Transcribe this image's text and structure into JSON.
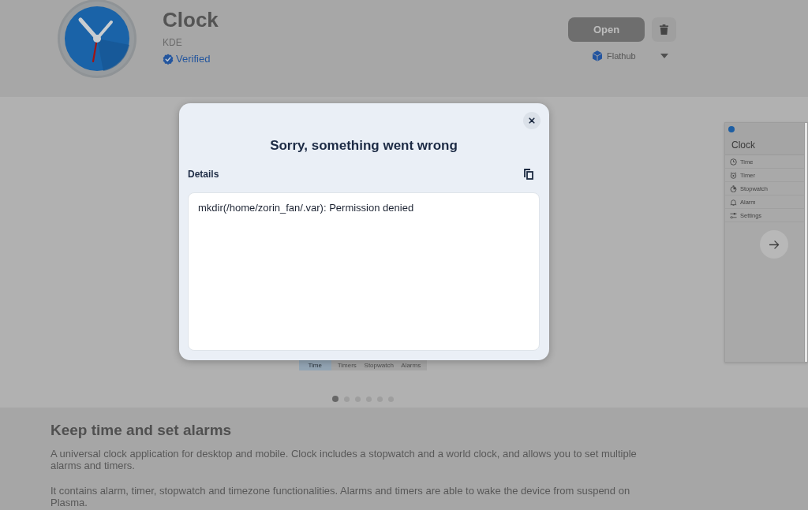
{
  "app_header": {
    "name": "Clock",
    "developer": "KDE",
    "verified_label": "Verified",
    "open_button": "Open",
    "source": "Flathub"
  },
  "screenshots": {
    "main_screenshot": {
      "tabs": [
        {
          "label": "Time",
          "selected": true
        },
        {
          "label": "Timers",
          "selected": false
        },
        {
          "label": "Stopwatch",
          "selected": false
        },
        {
          "label": "Alarms",
          "selected": false
        }
      ]
    },
    "next_screenshot": {
      "window_title": "Clock",
      "sidebar_items": [
        "Time",
        "Timer",
        "Stopwatch",
        "Alarm",
        "Settings"
      ]
    },
    "pager": [
      {
        "selected": true
      },
      {
        "selected": false
      },
      {
        "selected": false
      },
      {
        "selected": false
      },
      {
        "selected": false
      },
      {
        "selected": false
      }
    ]
  },
  "description": {
    "heading": "Keep time and set alarms",
    "paragraphs": [
      "A universal clock application for desktop and mobile. Clock includes a stopwatch and a world clock, and allows you to set multiple alarms and timers.",
      "It contains alarm, timer, stopwatch and timezone functionalities. Alarms and timers are able to wake the device from suspend on Plasma."
    ]
  },
  "dialog": {
    "title": "Sorry, something went wrong",
    "details_label": "Details",
    "details_text": "mkdir(/home/zorin_fan/.var): Permission denied"
  }
}
